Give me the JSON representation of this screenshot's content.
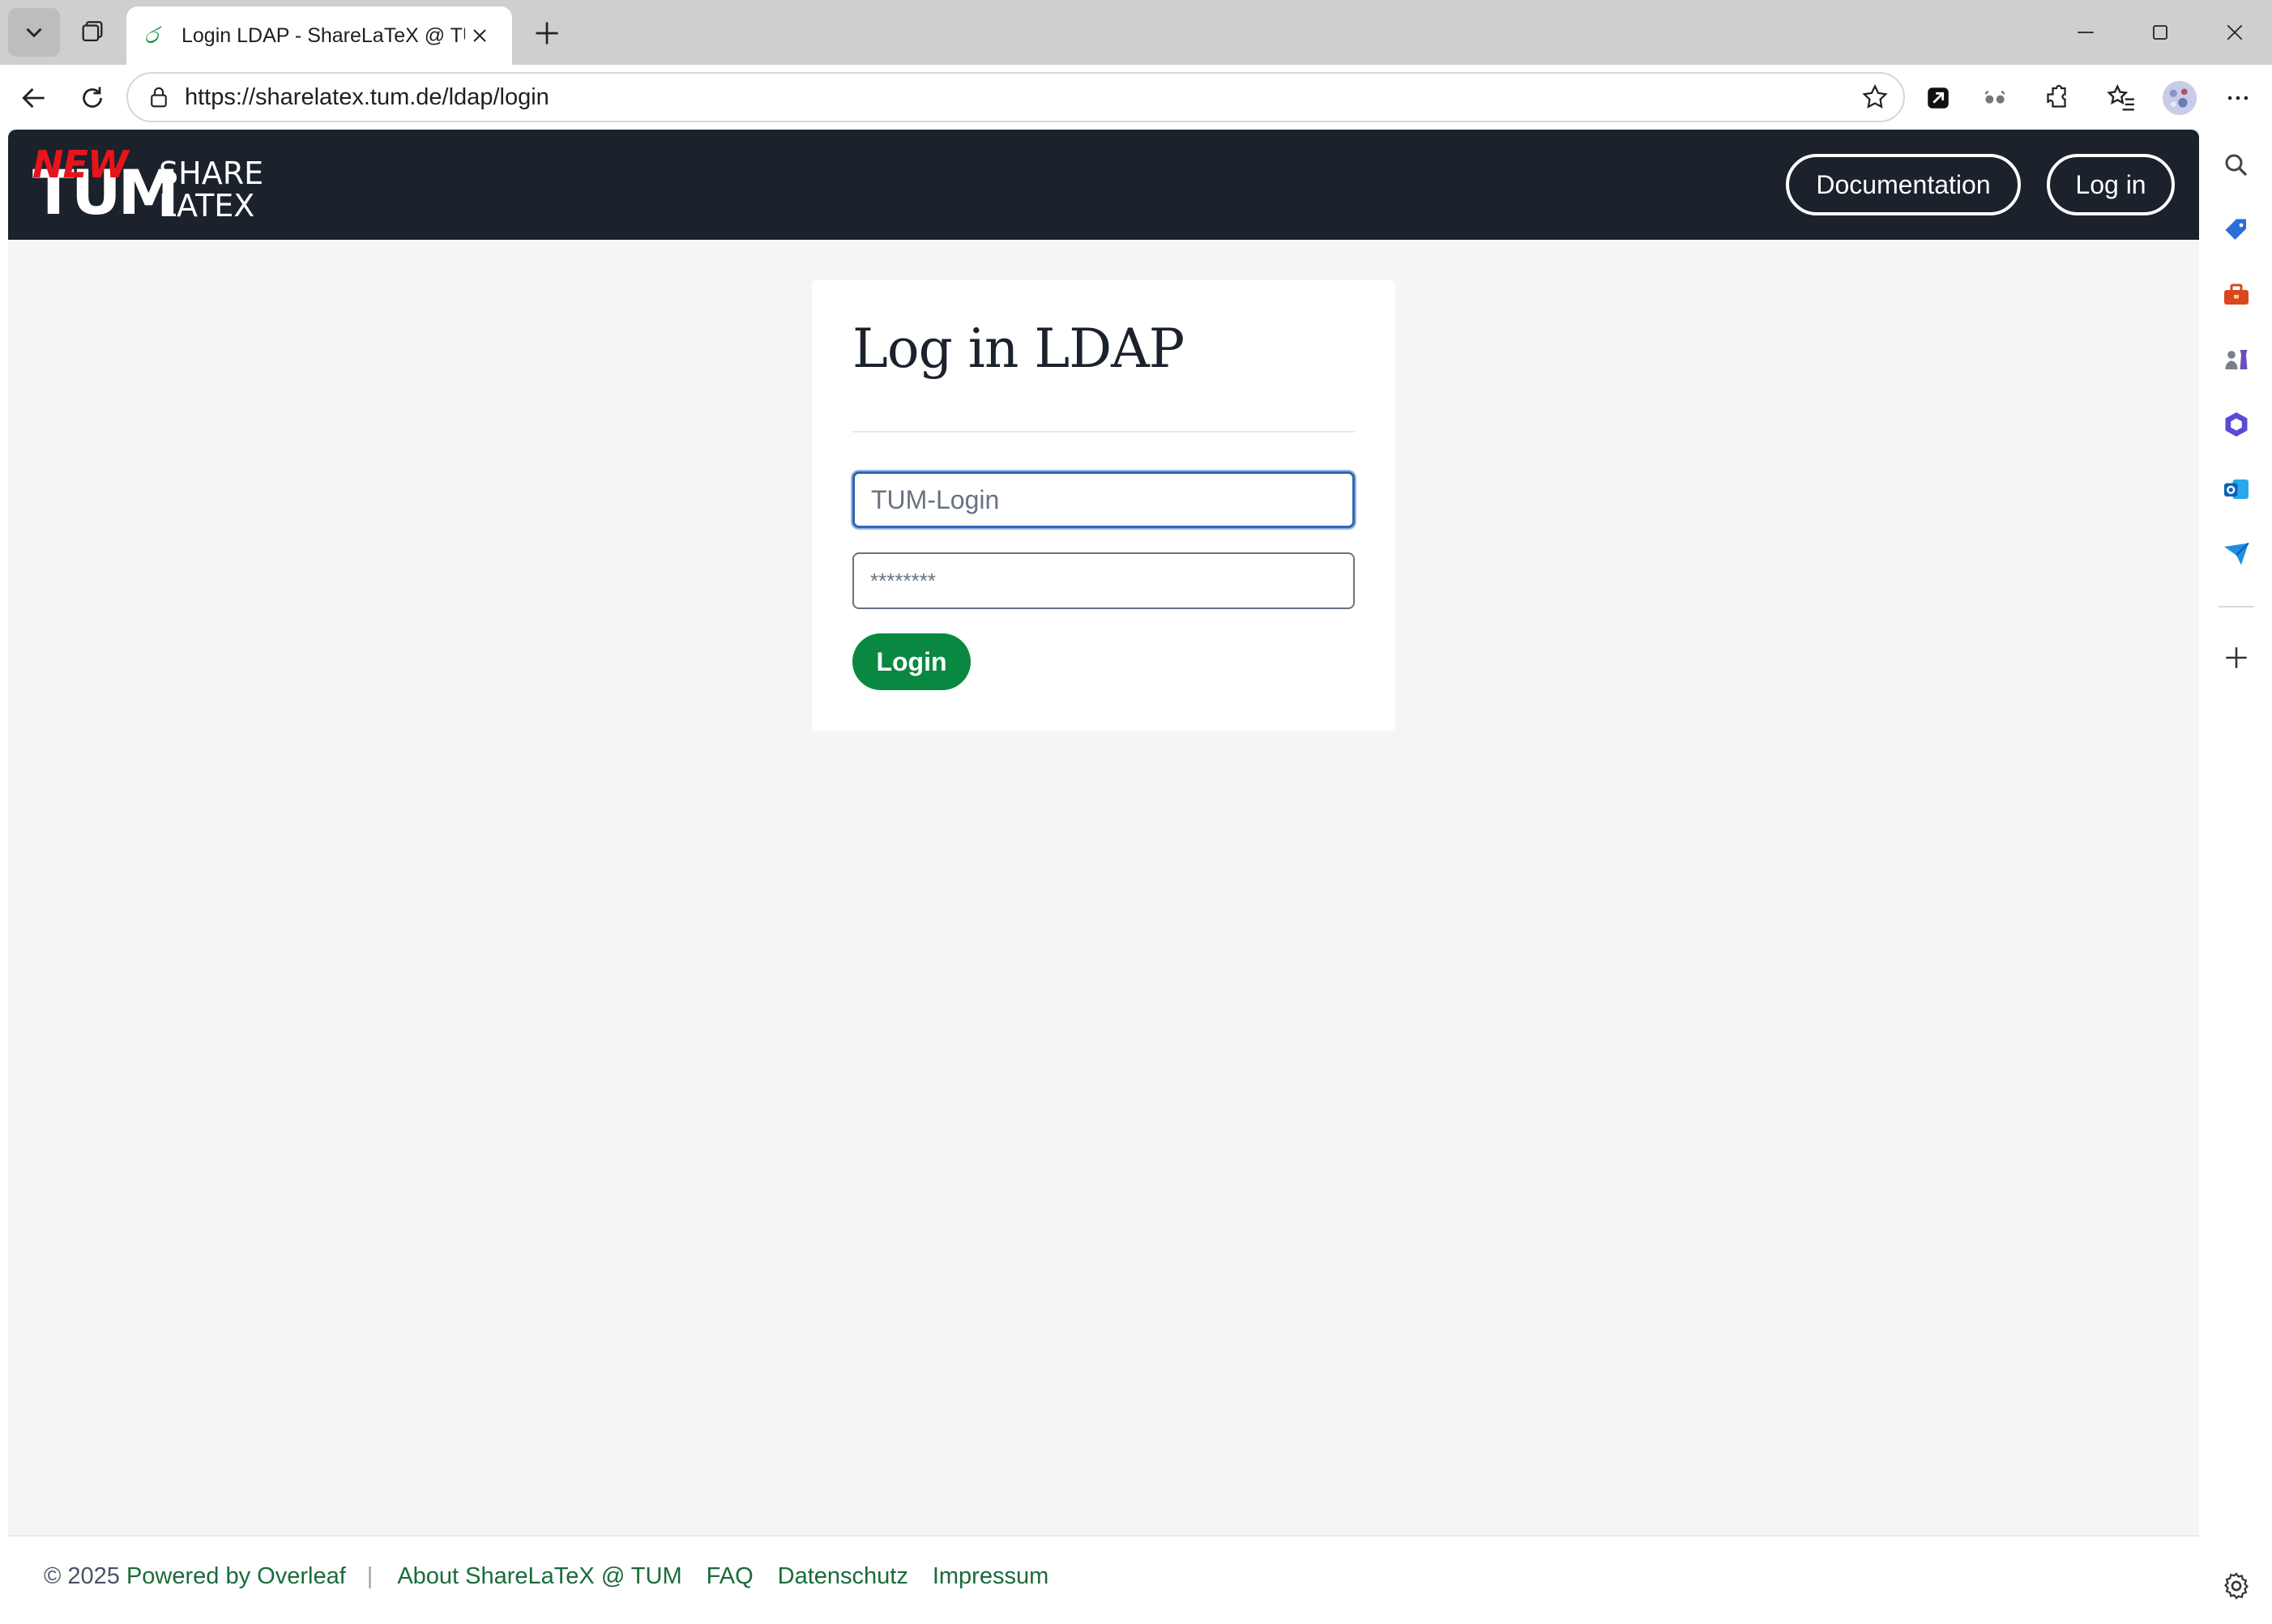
{
  "browser": {
    "tab_title": "Login LDAP - ShareLaTeX @ TUM,",
    "tab_favicon": "ර",
    "url": "https://sharelatex.tum.de/ldap/login"
  },
  "site": {
    "logo": {
      "tum": "TUM",
      "new": "NEW",
      "share": "SHARE",
      "latex": "LATEX"
    },
    "nav": {
      "documentation": "Documentation",
      "login": "Log in"
    }
  },
  "form": {
    "title": "Log in LDAP",
    "username_placeholder": "TUM-Login",
    "password_placeholder": "********",
    "submit": "Login"
  },
  "footer": {
    "copyright": "© 2025",
    "powered": "Powered by Overleaf",
    "separator": "|",
    "links": [
      "About ShareLaTeX @ TUM",
      "FAQ",
      "Datenschutz",
      "Impressum"
    ]
  },
  "colors": {
    "nav_bg": "#1b222c",
    "primary_green": "#098842",
    "link_green": "#1a6b3a",
    "logo_red": "#e8141c",
    "focus_blue": "#3265b2"
  }
}
